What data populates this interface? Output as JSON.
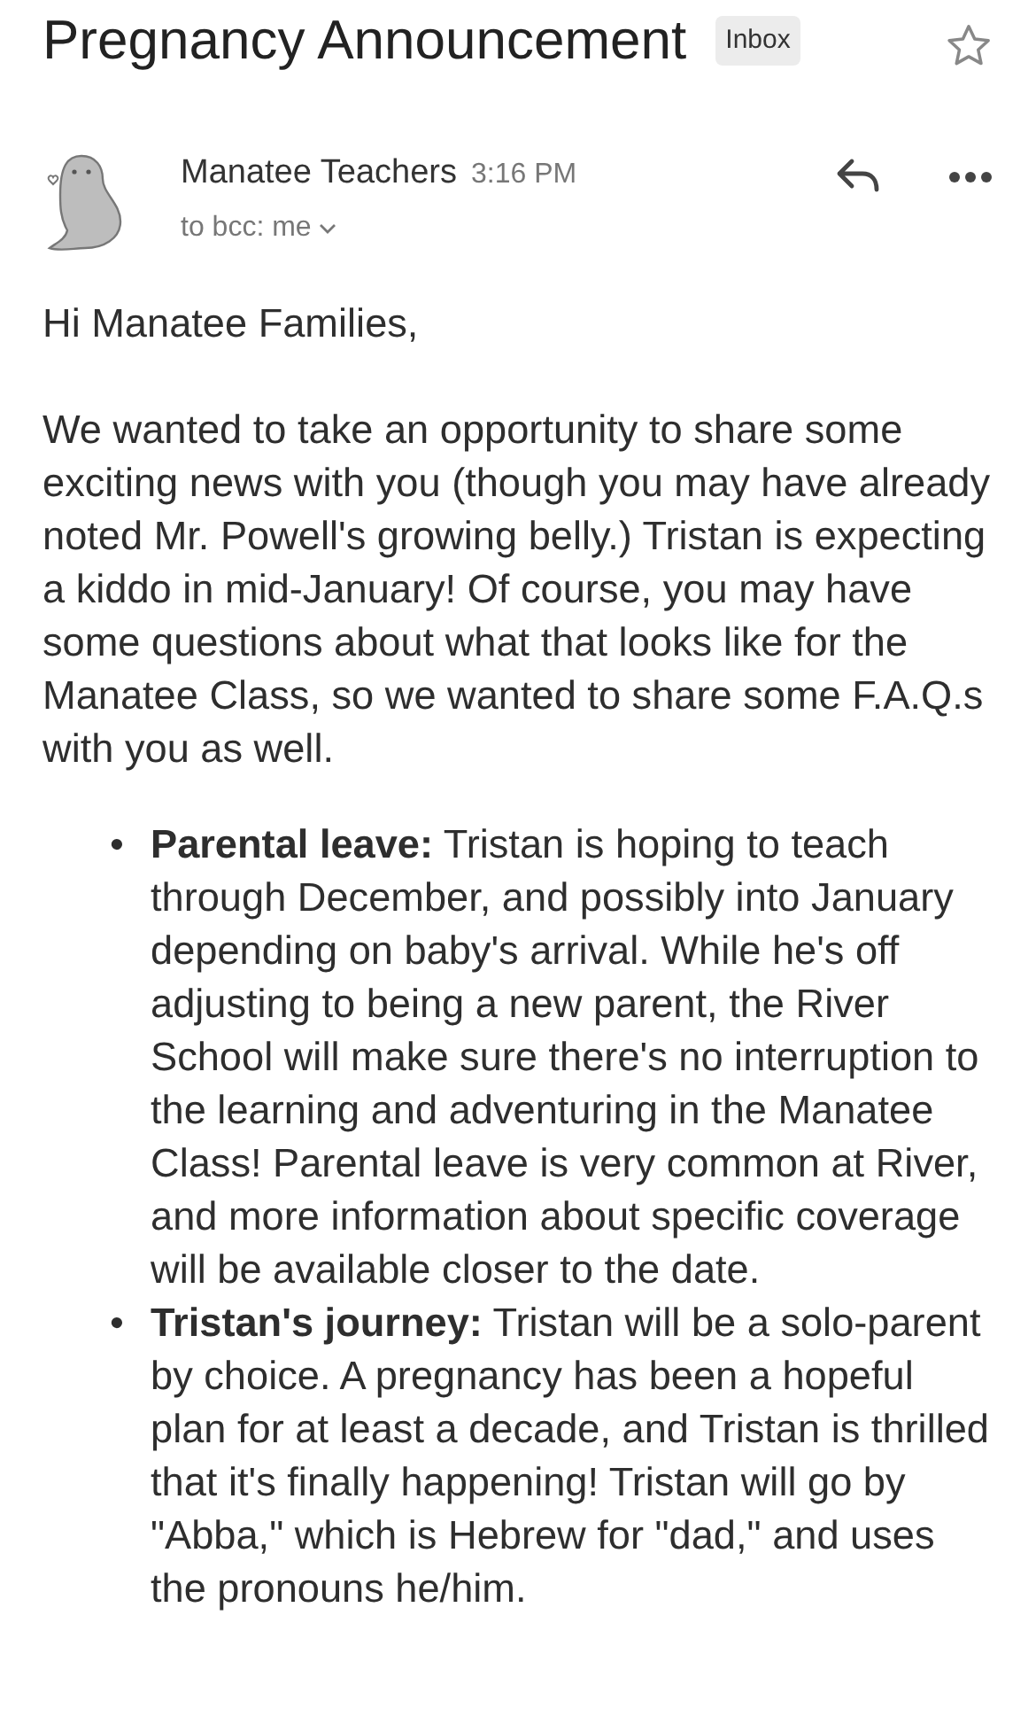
{
  "subject": "Pregnancy Announcement",
  "label": "Inbox",
  "starred": false,
  "sender": {
    "name": "Manatee Teachers",
    "time": "3:16 PM",
    "recipients": "to bcc: me"
  },
  "body": {
    "greeting": "Hi Manatee Families,",
    "paragraph": "We wanted to take an opportunity to share some exciting news with you (though you may have already noted Mr. Powell's growing belly.) Tristan is expecting a kiddo in mid-January! Of course, you may have some questions about what that looks like for the Manatee Class, so we wanted to share some F.A.Q.s with you as well.",
    "bullets": [
      {
        "marker": "•",
        "text": "**Parental leave:** Tristan is hoping to teach through December, and possibly into January depending on baby's arrival. While he's off adjusting to being a new parent, the River School will make sure there's no interruption to the learning and adventuring in the Manatee Class! Parental leave is very common at River, and more information about specific coverage will be available closer to the date."
      },
      {
        "marker": "•",
        "text": "**Tristan's journey:** Tristan will be a solo-parent by choice. A pregnancy has been a hopeful plan for at least a decade, and Tristan is thrilled that it's finally happening! Tristan will go by \"Abba,\" which is Hebrew for \"dad,\" and uses the pronouns he/him."
      }
    ]
  }
}
